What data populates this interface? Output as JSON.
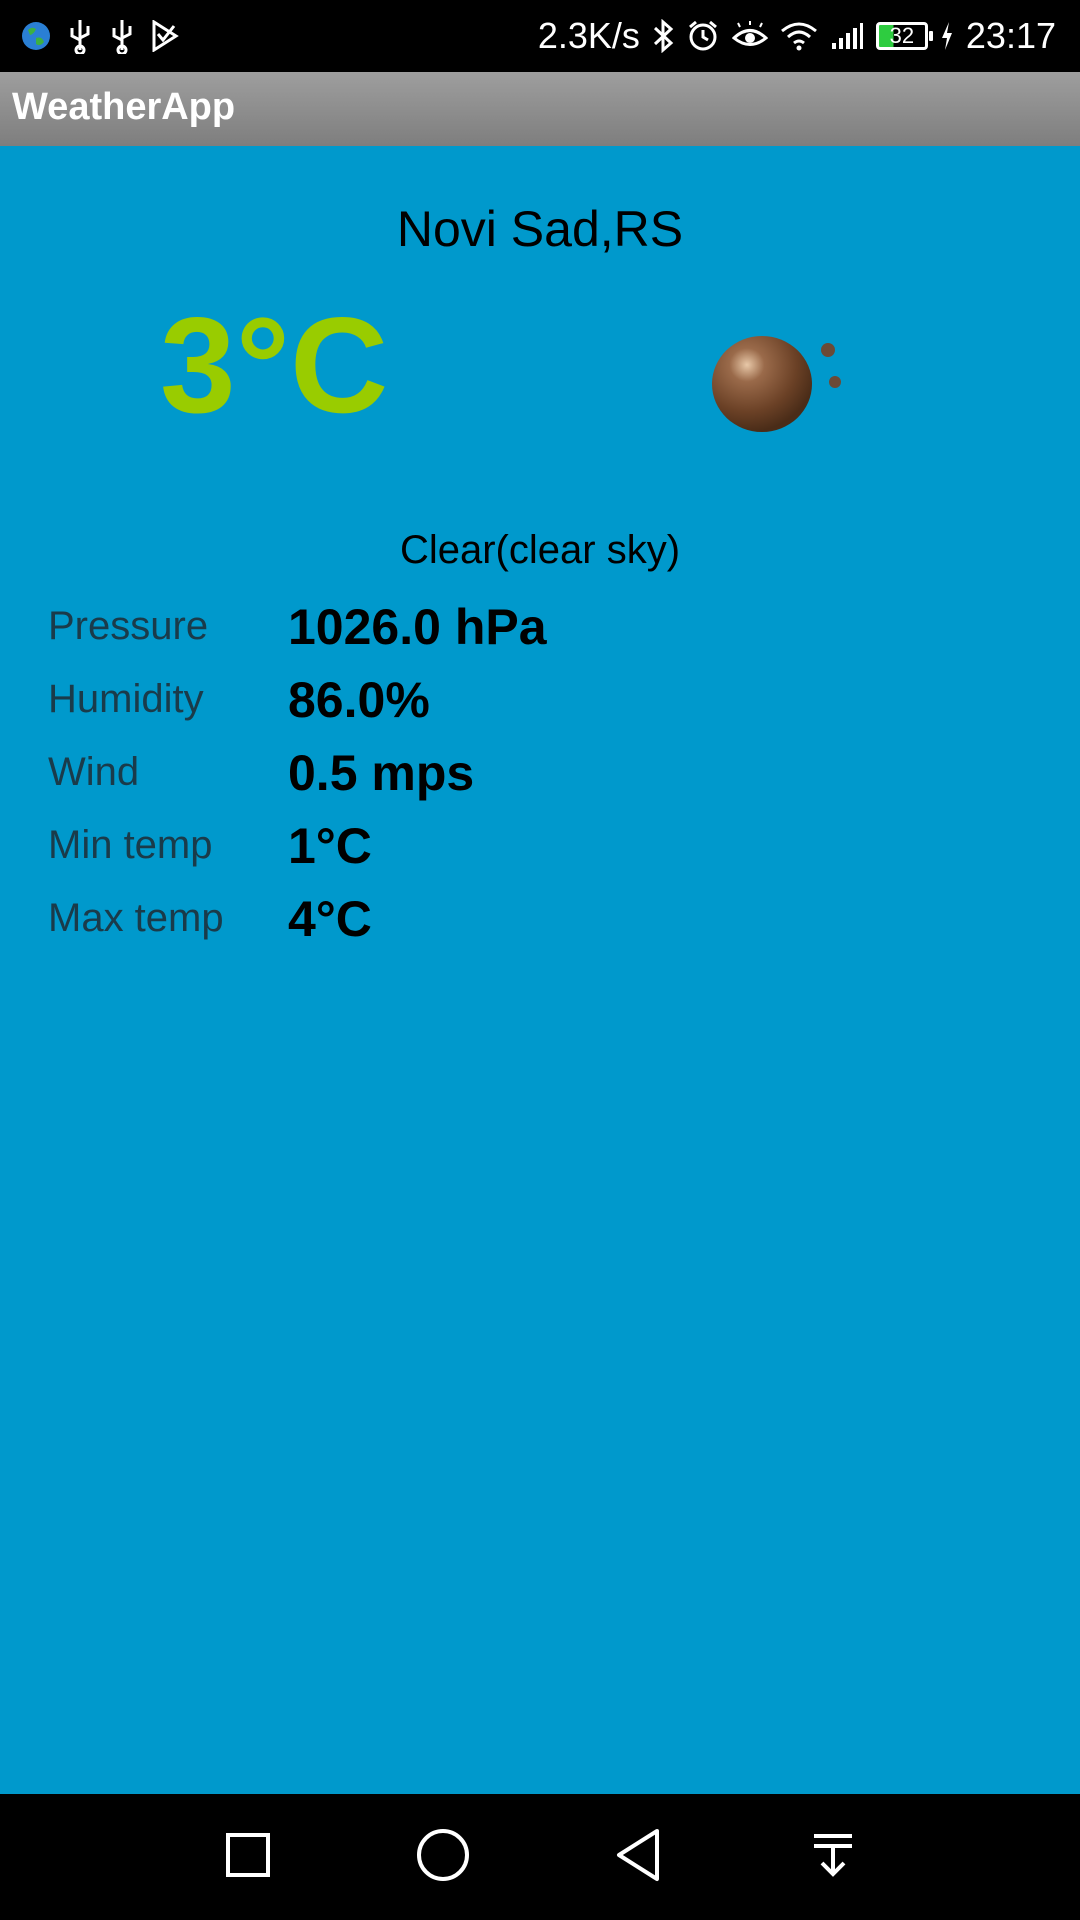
{
  "status_bar": {
    "left_icons": [
      "globe-icon",
      "usb-icon",
      "usb-icon",
      "play-store-icon"
    ],
    "network_speed": "2.3K/s",
    "right_icons": [
      "bluetooth-icon",
      "alarm-icon",
      "eye-comfort-icon",
      "wifi-icon",
      "signal-icon"
    ],
    "battery_level": "32",
    "time": "23:17"
  },
  "app": {
    "title": "WeatherApp"
  },
  "weather": {
    "city": "Novi Sad,RS",
    "temperature": "3°C",
    "icon": "clear-night-moon-icon",
    "condition": "Clear(clear sky)",
    "details": [
      {
        "label": "Pressure",
        "value": "1026.0 hPa"
      },
      {
        "label": "Humidity",
        "value": "86.0%"
      },
      {
        "label": "Wind",
        "value": "0.5 mps"
      },
      {
        "label": "Min temp",
        "value": "1°C"
      },
      {
        "label": "Max temp",
        "value": "4°C"
      }
    ]
  },
  "nav_bar": {
    "buttons": [
      "recents-icon",
      "home-icon",
      "back-icon",
      "notification-pull-down-icon"
    ]
  },
  "colors": {
    "background": "#0099cc",
    "temperature": "#99cc00",
    "action_bar": "#8a8a8a"
  }
}
